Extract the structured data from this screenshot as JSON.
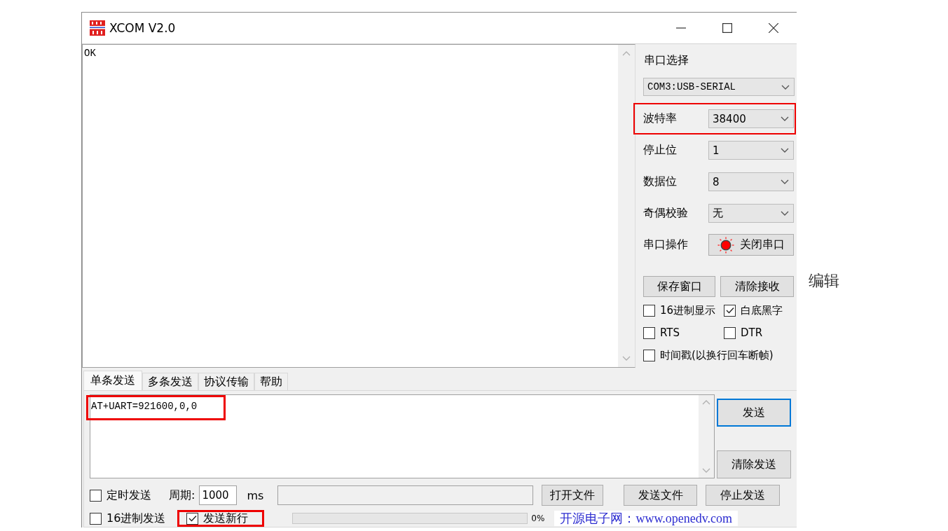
{
  "window": {
    "title": "XCOM V2.0"
  },
  "receive": {
    "text": "OK"
  },
  "serial_panel": {
    "title": "串口选择",
    "port": "COM3:USB-SERIAL",
    "settings": [
      {
        "label": "波特率",
        "value": "38400",
        "highlighted": true
      },
      {
        "label": "停止位",
        "value": "1",
        "highlighted": false
      },
      {
        "label": "数据位",
        "value": "8",
        "highlighted": false
      },
      {
        "label": "奇偶校验",
        "value": "无",
        "highlighted": false
      }
    ],
    "operation": {
      "label": "串口操作",
      "button": "关闭串口",
      "indicator_on": true
    },
    "buttons": [
      "保存窗口",
      "清除接收"
    ],
    "options": [
      {
        "label": "16进制显示",
        "checked": false
      },
      {
        "label": "白底黑字",
        "checked": true
      },
      {
        "label": "RTS",
        "checked": false
      },
      {
        "label": "DTR",
        "checked": false
      },
      {
        "label": "时间戳(以换行回车断帧)",
        "checked": false
      }
    ]
  },
  "send_tabs": [
    {
      "label": "单条发送",
      "selected": true
    },
    {
      "label": "多条发送",
      "selected": false
    },
    {
      "label": "协议传输",
      "selected": false
    },
    {
      "label": "帮助",
      "selected": false
    }
  ],
  "send": {
    "text": "AT+UART=921600,0,0",
    "highlighted": true,
    "buttons": [
      {
        "label": "发送",
        "focused": true
      },
      {
        "label": "清除发送",
        "focused": false
      }
    ]
  },
  "timer": {
    "label": "定时发送",
    "checked": false,
    "period_label": "周期:",
    "period": "1000",
    "unit": "ms"
  },
  "file_buttons": [
    "打开文件",
    "发送文件",
    "停止发送"
  ],
  "send_options": [
    {
      "label": "16进制发送",
      "checked": false,
      "highlighted": false
    },
    {
      "label": "发送新行",
      "checked": true,
      "highlighted": true
    }
  ],
  "progress": {
    "level": 0,
    "reading": "0%"
  },
  "website": "开源电子网：www.openedv.com",
  "side_link": "编辑"
}
